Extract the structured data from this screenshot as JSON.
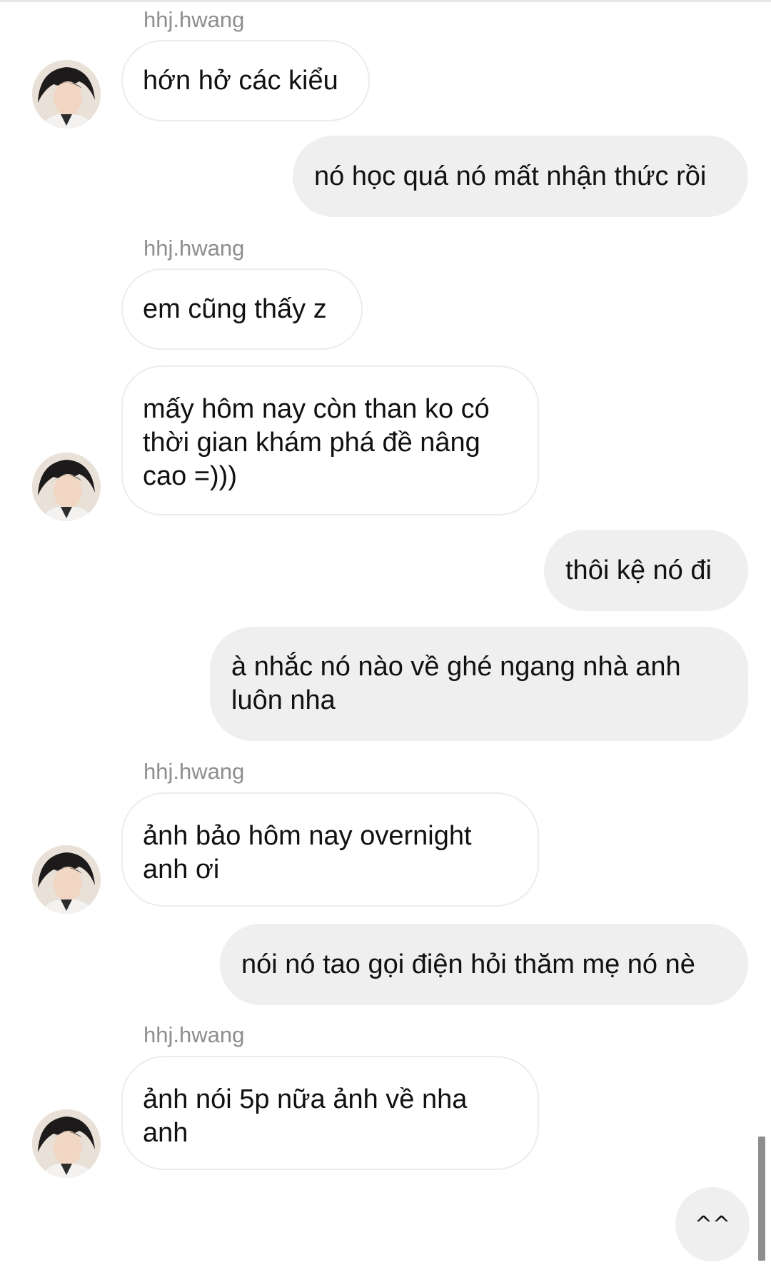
{
  "messages": [
    {
      "sender": "hhj.hwang",
      "text": "hớn hở các kiểu"
    },
    {
      "text": "nó học quá nó mất nhận thức rồi"
    },
    {
      "sender": "hhj.hwang",
      "text": "em cũng thấy z"
    },
    {
      "text": "mấy hôm nay còn than ko có thời gian khám phá đề nâng cao =)))"
    },
    {
      "text": "thôi kệ nó đi"
    },
    {
      "text": "à nhắc nó nào về ghé ngang nhà anh luôn nha"
    },
    {
      "sender": "hhj.hwang",
      "text": "ảnh bảo hôm nay overnight anh ơi"
    },
    {
      "text": "nói nó tao gọi điện hỏi thăm mẹ nó nè"
    },
    {
      "sender": "hhj.hwang",
      "text": "ảnh nói 5p nữa ảnh về nha anh"
    }
  ],
  "quick_reaction": {
    "label": "^^"
  },
  "colors": {
    "incoming_border": "#ececec",
    "outgoing_bubble": "#efefef",
    "sender_text": "#8e8e8e"
  },
  "icons": {
    "avatar": "avatar-photo",
    "scrollbar": "scrollbar-thumb"
  }
}
